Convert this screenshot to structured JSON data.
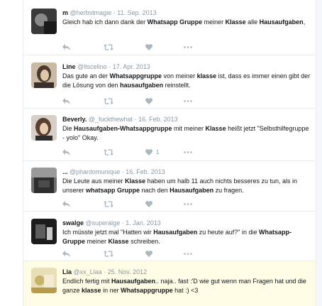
{
  "tweets": [
    {
      "name": "m",
      "handle": "@herbstmagie",
      "date": "11. Sep. 2013",
      "segments": [
        {
          "t": "Gleich hab ich dann dank der ",
          "b": false
        },
        {
          "t": "Whatsapp Gruppe",
          "b": true
        },
        {
          "t": " meiner ",
          "b": false
        },
        {
          "t": "Klasse",
          "b": true
        },
        {
          "t": " alle ",
          "b": false
        },
        {
          "t": "Hausaufgaben",
          "b": true
        },
        {
          "t": ",",
          "b": false
        }
      ],
      "likes": ""
    },
    {
      "name": "Line",
      "handle": "@ltscelino",
      "date": "17. Apr. 2013",
      "segments": [
        {
          "t": "Das gute an der ",
          "b": false
        },
        {
          "t": "Whatsappgruppe",
          "b": true
        },
        {
          "t": " von meiner ",
          "b": false
        },
        {
          "t": "klasse",
          "b": true
        },
        {
          "t": " ist, dass es immer einen gibt der die Lösung von den ",
          "b": false
        },
        {
          "t": "hausaufgaben",
          "b": true
        },
        {
          "t": " reinstellt.",
          "b": false
        }
      ],
      "likes": ""
    },
    {
      "name": "Beverly.",
      "handle": "@_fuckthewhat",
      "date": "16. Feb. 2013",
      "segments": [
        {
          "t": "Die ",
          "b": false
        },
        {
          "t": "Hausaufgaben-Whatsappgruppe",
          "b": true
        },
        {
          "t": " mit meiner ",
          "b": false
        },
        {
          "t": "Klasse",
          "b": true
        },
        {
          "t": " heißt jetzt \"Selbsthilfegruppe - yolo\" Okay.",
          "b": false
        }
      ],
      "likes": "1"
    },
    {
      "name": "...",
      "handle": "@phantomunique",
      "date": "16. Feb. 2013",
      "segments": [
        {
          "t": "Die Leute aus meiner ",
          "b": false
        },
        {
          "t": "Klasse",
          "b": true
        },
        {
          "t": " haben um halb 11 auch nichts besseres zu tun, als in unserer ",
          "b": false
        },
        {
          "t": "whatsapp Gruppe",
          "b": true
        },
        {
          "t": " nach den ",
          "b": false
        },
        {
          "t": "Hausaufgaben",
          "b": true
        },
        {
          "t": " zu fragen.",
          "b": false
        }
      ],
      "likes": ""
    },
    {
      "name": "swalge",
      "handle": "@superalge",
      "date": "1. Jan. 2013",
      "segments": [
        {
          "t": "Ich müsste jetzt mal \"Hatten wir ",
          "b": false
        },
        {
          "t": "Hausaufgaben",
          "b": true
        },
        {
          "t": " zu heute auf?\" in die ",
          "b": false
        },
        {
          "t": "Whatsapp-Gruppe",
          "b": true
        },
        {
          "t": " meiner ",
          "b": false
        },
        {
          "t": "Klasse",
          "b": true
        },
        {
          "t": " schreiben.",
          "b": false
        }
      ],
      "likes": ""
    },
    {
      "name": "Lia",
      "handle": "@xx_Liaa",
      "date": "25. Nov. 2012",
      "segments": [
        {
          "t": "Endlich fertig mit ",
          "b": false
        },
        {
          "t": "Hausaufgaben",
          "b": true
        },
        {
          "t": ".. naja.. fast :'D wie gut wenn man Fragen hat und die ganze ",
          "b": false
        },
        {
          "t": "klasse",
          "b": true
        },
        {
          "t": " in ner ",
          "b": false
        },
        {
          "t": "Whatsappgruppe",
          "b": true
        },
        {
          "t": " hat :) <3",
          "b": false
        }
      ],
      "likes": ""
    }
  ],
  "separator": "·",
  "icons": {
    "reply": "reply-icon",
    "retweet": "retweet-icon",
    "like": "heart-icon",
    "more": "more-icon"
  },
  "colors": {
    "name": "#14171a",
    "meta": "#8899a6",
    "action": "#aab8c2",
    "highlight": "#fffce6"
  }
}
